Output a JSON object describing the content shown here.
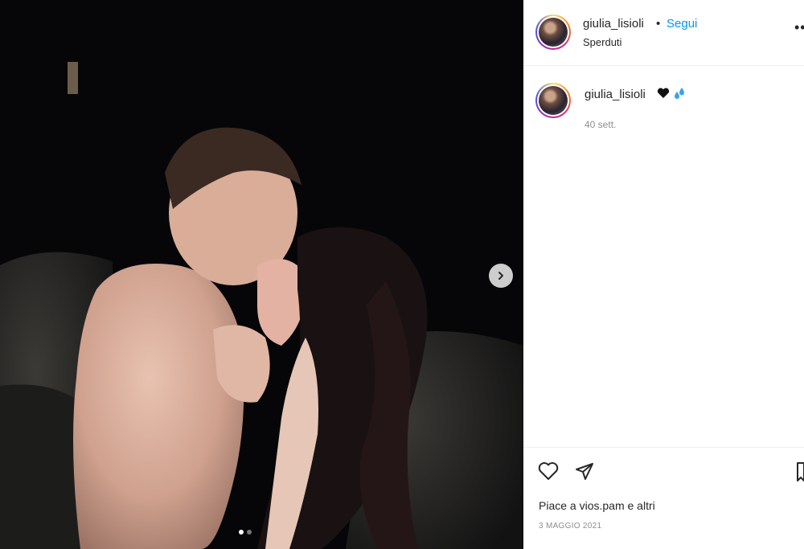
{
  "post": {
    "username": "giulia_lisioli",
    "follow_label": "Segui",
    "separator": "•",
    "location": "Sperduti",
    "more_label": "•••",
    "media_alt": "Photo: couple kissing at night",
    "carousel": {
      "total_slides": 2,
      "active_index": 0
    }
  },
  "caption": {
    "username": "giulia_lisioli",
    "emojis": [
      "black-heart",
      "sweat-droplets"
    ],
    "time": "40 sett."
  },
  "footer": {
    "likes_text": "Piace a vios.pam e altri",
    "date": "3 MAGGIO 2021"
  },
  "colors": {
    "accent": "#0095f6",
    "text": "#262626",
    "muted": "#8e8e8e"
  }
}
